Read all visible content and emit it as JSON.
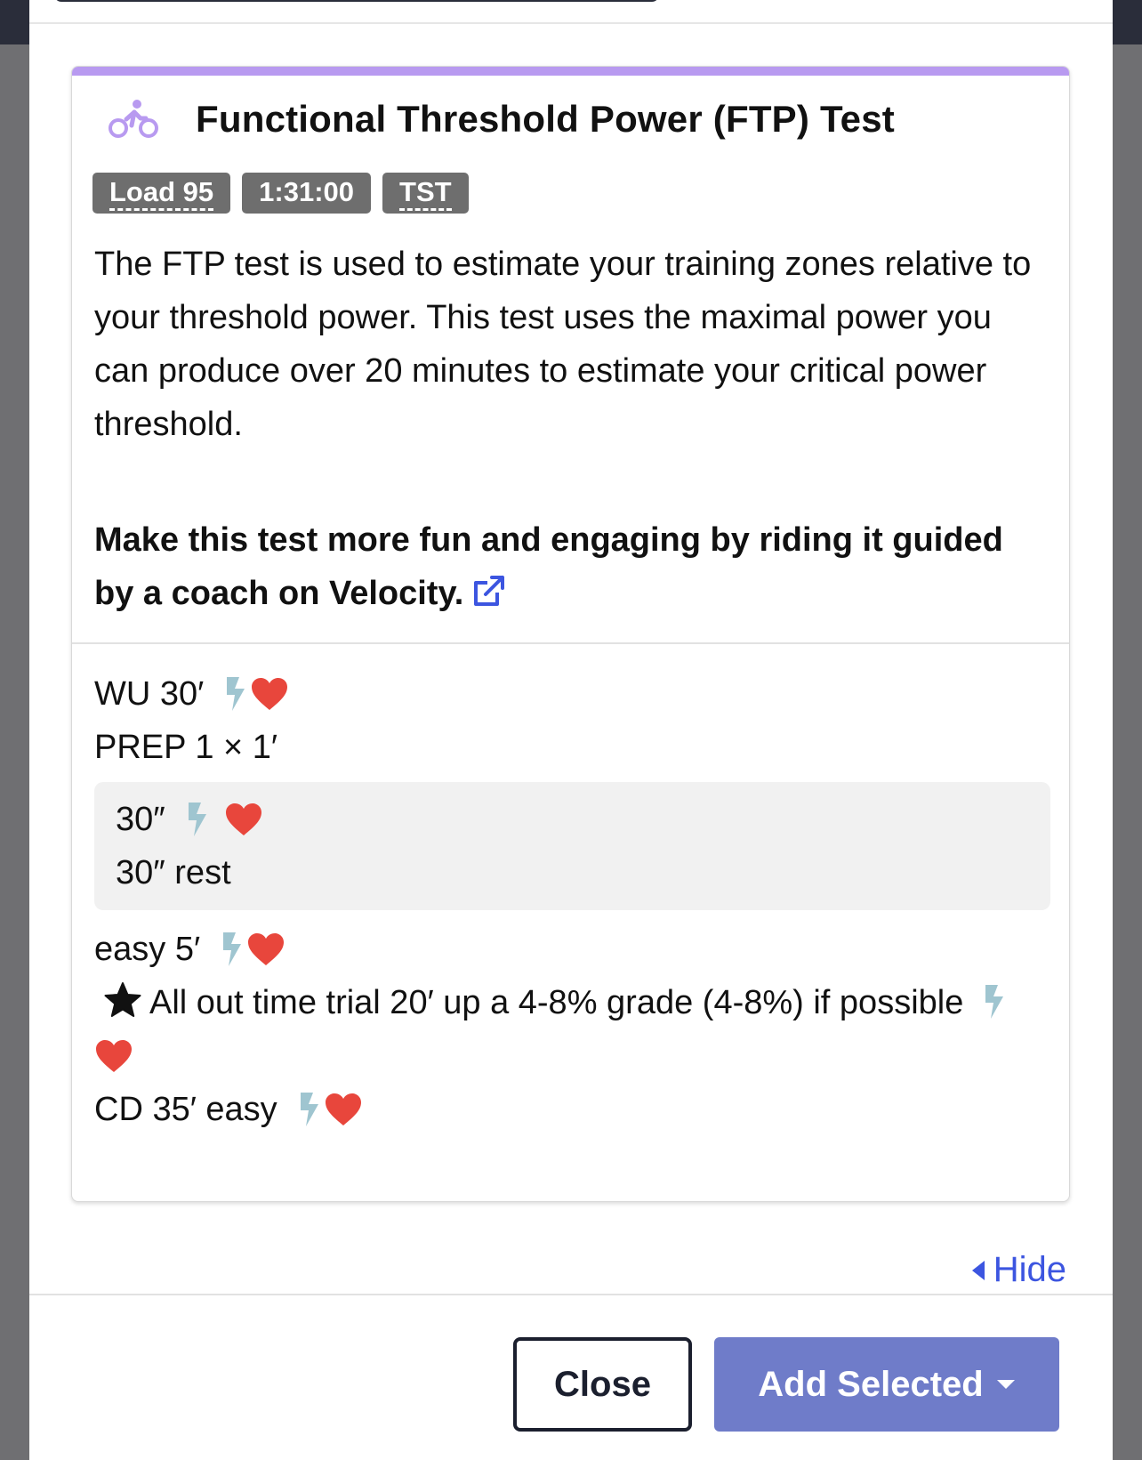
{
  "workout": {
    "title": "Functional Threshold Power (FTP) Test",
    "sport_icon": "bike-icon",
    "badges": [
      "Load 95",
      "1:31:00",
      "TST"
    ],
    "description": "The FTP test is used to estimate your training zones relative to your threshold power. This test uses the maximal power you can produce over 20 minutes to estimate your critical power threshold.",
    "promo": "Make this test more fun and engaging by riding it guided by a coach on Velocity.",
    "steps": {
      "warmup": "WU 30′",
      "prep": "PREP 1 × 1′",
      "prep_on": "30″",
      "prep_rest": "30″ rest",
      "easy": "easy 5′",
      "trial": "All out time trial 20′ up a 4-8% grade (4-8%) if possible",
      "cooldown": "CD 35′ easy"
    }
  },
  "hide_label": "Hide",
  "footer": {
    "close_label": "Close",
    "add_label": "Add Selected"
  },
  "colors": {
    "accent": "#b89af0",
    "power_icon": "#9fc5d0",
    "heart": "#e8463c",
    "link": "#3c55e0",
    "primary_button": "#6f7cc9"
  }
}
